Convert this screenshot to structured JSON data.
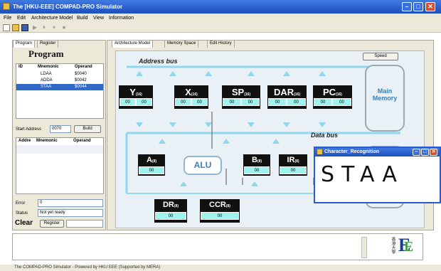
{
  "window": {
    "title": "The [HKU-EEE] COMPAD-PRO Simulator"
  },
  "menu": {
    "items": [
      "File",
      "Edit",
      "Architecture Model",
      "Build",
      "View",
      "Information"
    ]
  },
  "left": {
    "tabs": [
      "Program",
      "Register"
    ],
    "title": "Program",
    "columns": [
      "ID",
      "Mnemonic",
      "Operand"
    ],
    "rows": [
      {
        "mnemonic": "LDAA",
        "operand": "$0040"
      },
      {
        "mnemonic": "ADDA",
        "operand": "$0042"
      },
      {
        "mnemonic": "STAA",
        "operand": "$0044"
      }
    ],
    "start_address_label": "Start Address",
    "start_address_value": "0070",
    "build_label": "Build",
    "columns2": [
      "Addre",
      "Mnemonic",
      "Operand"
    ],
    "error_label": "Error",
    "error_value": "0",
    "status_label": "Status",
    "status_value": "Not yet ready",
    "clear_label": "Clear",
    "register_button": "Register"
  },
  "right": {
    "tabs": [
      "Architecture Model",
      "Memory Space",
      "Edit History"
    ],
    "speed_label": "Speed",
    "address_bus": "Address bus",
    "data_bus": "Data bus",
    "main_memory": "Main Memory",
    "alu": "ALU"
  },
  "registers": {
    "Y": {
      "name": "Y",
      "bits": "(16)",
      "cells": [
        "00",
        "00"
      ]
    },
    "X": {
      "name": "X",
      "bits": "(16)",
      "cells": [
        "00",
        "00"
      ]
    },
    "SP": {
      "name": "SP",
      "bits": "(16)",
      "cells": [
        "00",
        "00"
      ]
    },
    "DAR": {
      "name": "DAR",
      "bits": "(16)",
      "cells": [
        "00",
        "00"
      ]
    },
    "PC": {
      "name": "PC",
      "bits": "(16)",
      "cells": [
        "00",
        "00"
      ]
    },
    "A": {
      "name": "A",
      "bits": "(8)",
      "cells": [
        "00"
      ]
    },
    "B": {
      "name": "B",
      "bits": "(8)",
      "cells": [
        "00"
      ]
    },
    "IR": {
      "name": "IR",
      "bits": "(8)",
      "cells": [
        "00"
      ]
    },
    "DR": {
      "name": "DR",
      "bits": "(8)",
      "cells": [
        "00"
      ]
    },
    "CCR": {
      "name": "CCR",
      "bits": "(8)",
      "cells": [
        "00"
      ]
    }
  },
  "charwin": {
    "title": "Character_Recognition",
    "text": "STAA"
  },
  "logo": {
    "text": "香港大學"
  },
  "statusbar": "The COMPAD-PRO Simulator - Powered by HKU EEE (Supported by MERA)"
}
